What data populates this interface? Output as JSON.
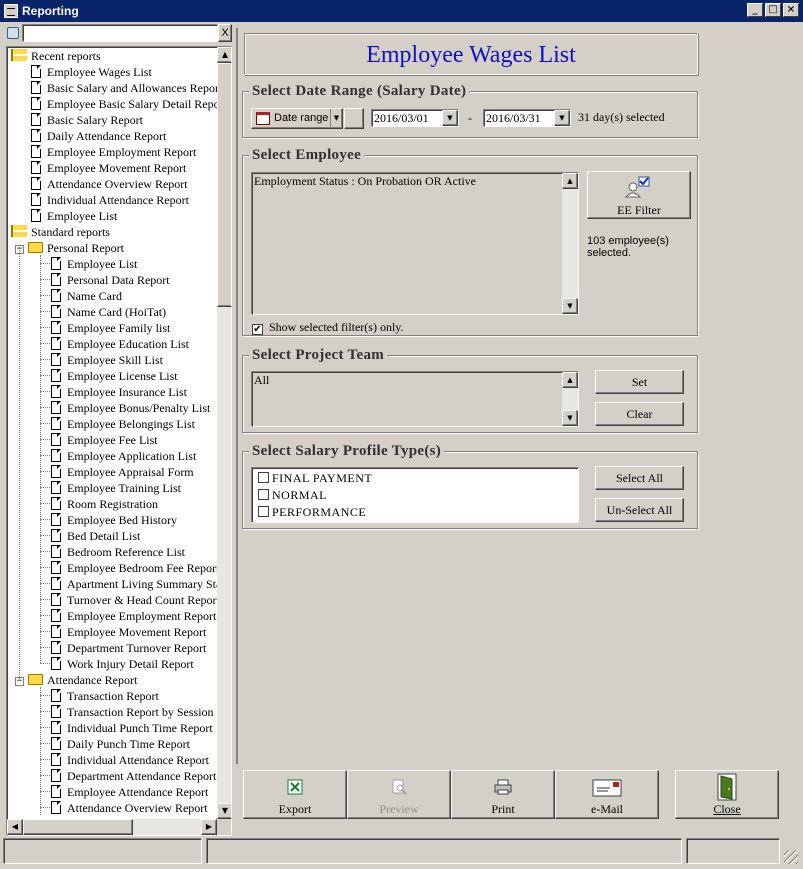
{
  "window": {
    "title": "Reporting",
    "buttons": {
      "minimize": "_",
      "maximize": "□",
      "close": "×"
    }
  },
  "search": {
    "value": "",
    "clear_label": "X"
  },
  "tree": {
    "recent": {
      "label": "Recent reports",
      "items": [
        "Employee Wages List",
        "Basic Salary and Allowances Report",
        "Employee Basic Salary Detail Report",
        "Basic Salary Report",
        "Daily Attendance Report",
        "Employee Employment Report",
        "Employee Movement Report",
        "Attendance Overview Report",
        "Individual Attendance Report",
        "Employee List"
      ]
    },
    "standard": {
      "label": "Standard reports",
      "personal": {
        "label": "Personal Report",
        "items": [
          "Employee List",
          "Personal Data Report",
          "Name Card",
          "Name Card (HoiTat)",
          "Employee Family list",
          "Employee Education List",
          "Employee Skill List",
          "Employee License List",
          "Employee Insurance List",
          "Employee Bonus/Penalty List",
          "Employee Belongings List",
          "Employee Fee List",
          "Employee Application List",
          "Employee Appraisal Form",
          "Employee Training List",
          "Room Registration",
          "Employee Bed History",
          "Bed Detail List",
          "Bedroom Reference List",
          "Employee Bedroom Fee Report",
          "Apartment Living Summary Statement",
          "Turnover & Head Count Report",
          "Employee Employment Report",
          "Employee Movement Report",
          "Department Turnover Report",
          "Work Injury Detail Report"
        ]
      },
      "attendance": {
        "label": "Attendance Report",
        "items": [
          "Transaction Report",
          "Transaction Report by Session",
          "Individual Punch Time Report",
          "Daily Punch Time Report",
          "Individual Attendance Report",
          "Department Attendance Report",
          "Employee Attendance Report",
          "Attendance Overview Report"
        ]
      }
    }
  },
  "header": {
    "title": "Employee Wages List",
    "title_color": "#1010c0"
  },
  "date_range": {
    "label": "Select Date Range (Salary Date)",
    "mode_label": "Date range",
    "from": "2016/03/01",
    "separator": "-",
    "to": "2016/03/31",
    "summary": "31 day(s) selected"
  },
  "employee": {
    "label": "Select Employee",
    "filter_text": "Employment Status : On Probation OR Active",
    "filter_button": "EE Filter",
    "count_text": "103 employee(s) selected.",
    "show_selected_label": "Show selected filter(s) only.",
    "show_selected_checked": true
  },
  "project_team": {
    "label": "Select Project Team",
    "value": "All",
    "set_label": "Set",
    "clear_label": "Clear"
  },
  "salary_profile": {
    "label": "Select Salary Profile Type(s)",
    "options": [
      {
        "label": "FINAL PAYMENT",
        "checked": false
      },
      {
        "label": "NORMAL",
        "checked": false
      },
      {
        "label": "PERFORMANCE",
        "checked": false
      }
    ],
    "select_all_label": "Select All",
    "unselect_all_label": "Un-Select All"
  },
  "toolbar": {
    "export": "Export",
    "preview": "Preview",
    "print": "Print",
    "email": "e-Mail",
    "close": "Close"
  },
  "status": {
    "left": "",
    "middle": "",
    "right": ""
  }
}
